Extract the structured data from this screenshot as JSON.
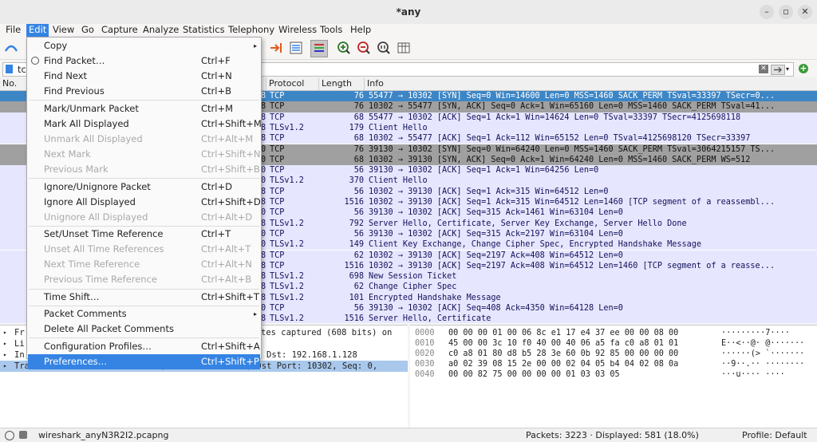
{
  "window": {
    "title": "*any",
    "minimize": "–",
    "maximize": "▫",
    "close": "✕"
  },
  "menubar": [
    "File",
    "Edit",
    "View",
    "Go",
    "Capture",
    "Analyze",
    "Statistics",
    "Telephony",
    "Wireless",
    "Tools",
    "Help"
  ],
  "filter": {
    "value": "tcp"
  },
  "columns": {
    "no": "No.",
    "protocol": "Protocol",
    "length": "Length",
    "info": "Info"
  },
  "packets": [
    {
      "p": "8",
      "proto": "TCP",
      "len": "76",
      "info": "55477 → 10302 [SYN] Seq=0 Win=14600 Len=0 MSS=1460 SACK_PERM TSval=33397 TSecr=0..."
    },
    {
      "p": "8",
      "proto": "TCP",
      "len": "76",
      "info": "10302 → 55477 [SYN, ACK] Seq=0 Ack=1 Win=65160 Len=0 MSS=1460 SACK_PERM TSval=41..."
    },
    {
      "p": "8",
      "proto": "TCP",
      "len": "68",
      "info": "55477 → 10302 [ACK] Seq=1 Ack=1 Win=14624 Len=0 TSval=33397 TSecr=4125698118"
    },
    {
      "p": "8",
      "proto": "TLSv1.2",
      "len": "179",
      "info": "Client Hello"
    },
    {
      "p": "8",
      "proto": "TCP",
      "len": "68",
      "info": "10302 → 55477 [ACK] Seq=1 Ack=112 Win=65152 Len=0 TSval=4125698120 TSecr=33397"
    },
    {
      "p": "0",
      "proto": "TCP",
      "len": "76",
      "info": "39130 → 10302 [SYN] Seq=0 Win=64240 Len=0 MSS=1460 SACK_PERM TSval=3064215157 TS..."
    },
    {
      "p": "0",
      "proto": "TCP",
      "len": "68",
      "info": "10302 → 39130 [SYN, ACK] Seq=0 Ack=1 Win=64240 Len=0 MSS=1460 SACK_PERM WS=512"
    },
    {
      "p": "0",
      "proto": "TCP",
      "len": "56",
      "info": "39130 → 10302 [ACK] Seq=1 Ack=1 Win=64256 Len=0"
    },
    {
      "p": "0",
      "proto": "TLSv1.2",
      "len": "370",
      "info": "Client Hello"
    },
    {
      "p": "8",
      "proto": "TCP",
      "len": "56",
      "info": "10302 → 39130 [ACK] Seq=1 Ack=315 Win=64512 Len=0"
    },
    {
      "p": "8",
      "proto": "TCP",
      "len": "1516",
      "info": "10302 → 39130 [ACK] Seq=1 Ack=315 Win=64512 Len=1460 [TCP segment of a reassembl..."
    },
    {
      "p": "0",
      "proto": "TCP",
      "len": "56",
      "info": "39130 → 10302 [ACK] Seq=315 Ack=1461 Win=63104 Len=0"
    },
    {
      "p": "8",
      "proto": "TLSv1.2",
      "len": "792",
      "info": "Server Hello, Certificate, Server Key Exchange, Server Hello Done"
    },
    {
      "p": "0",
      "proto": "TCP",
      "len": "56",
      "info": "39130 → 10302 [ACK] Seq=315 Ack=2197 Win=63104 Len=0"
    },
    {
      "p": "0",
      "proto": "TLSv1.2",
      "len": "149",
      "info": "Client Key Exchange, Change Cipher Spec, Encrypted Handshake Message"
    },
    {
      "p": "8",
      "proto": "TCP",
      "len": "62",
      "info": "10302 → 39130 [ACK] Seq=2197 Ack=408 Win=64512 Len=0"
    },
    {
      "p": "8",
      "proto": "TCP",
      "len": "1516",
      "info": "10302 → 39130 [ACK] Seq=2197 Ack=408 Win=64512 Len=1460 [TCP segment of a reasse..."
    },
    {
      "p": "8",
      "proto": "TLSv1.2",
      "len": "698",
      "info": "New Session Ticket"
    },
    {
      "p": "8",
      "proto": "TLSv1.2",
      "len": "62",
      "info": "Change Cipher Spec"
    },
    {
      "p": "8",
      "proto": "TLSv1.2",
      "len": "101",
      "info": "Encrypted Handshake Message"
    },
    {
      "p": "0",
      "proto": "TCP",
      "len": "56",
      "info": "39130 → 10302 [ACK] Seq=408 Ack=4350 Win=64128 Len=0"
    },
    {
      "p": "8",
      "proto": "TLSv1.2",
      "len": "1516",
      "info": "Server Hello, Certificate"
    }
  ],
  "details": [
    {
      "pre": "Fr",
      "post": "tes captured (608 bits) on"
    },
    {
      "pre": "Li",
      "post": ""
    },
    {
      "pre": "In",
      "post": "Dst: 192.168.1.128"
    },
    {
      "pre": "",
      "post": "Transmission Control Protocol, Src Port: 55477, Dst Port: 10302, Seq: 0,"
    }
  ],
  "bytes": [
    {
      "off": "0000",
      "hex": "00 00 00 01 00 06 8c e1  17 e4 37 ee 00 00 08 00",
      "ascii": "·········7····"
    },
    {
      "off": "0010",
      "hex": "45 00 00 3c 10 f0 40 00  40 06 a5 fa c0 a8 01 01",
      "ascii": "E··<··@· @·······"
    },
    {
      "off": "0020",
      "hex": "c0 a8 01 80 d8 b5 28 3e  60 0b 92 85 00 00 00 00",
      "ascii": "······(> `·······"
    },
    {
      "off": "0030",
      "hex": "a0 02 39 08 15 2e 00 00  02 04 05 b4 04 02 08 0a",
      "ascii": "··9··.·· ········"
    },
    {
      "off": "0040",
      "hex": "00 00 82 75 00 00 00 00  01 03 03 05",
      "ascii": "···u···· ····"
    }
  ],
  "statusbar": {
    "file": "wireshark_anyN3R2I2.pcapng",
    "packets": "Packets: 3223 · Displayed: 581 (18.0%)",
    "profile": "Profile: Default"
  },
  "edit_menu": [
    {
      "label": "Copy",
      "shortcut": "",
      "sub": true
    },
    {
      "label": "Find Packet…",
      "shortcut": "Ctrl+F",
      "icon": true
    },
    {
      "label": "Find Next",
      "shortcut": "Ctrl+N"
    },
    {
      "label": "Find Previous",
      "shortcut": "Ctrl+B"
    },
    {
      "sep": true
    },
    {
      "label": "Mark/Unmark Packet",
      "shortcut": "Ctrl+M"
    },
    {
      "label": "Mark All Displayed",
      "shortcut": "Ctrl+Shift+M"
    },
    {
      "label": "Unmark All Displayed",
      "shortcut": "Ctrl+Alt+M",
      "dis": true
    },
    {
      "label": "Next Mark",
      "shortcut": "Ctrl+Shift+N",
      "dis": true
    },
    {
      "label": "Previous Mark",
      "shortcut": "Ctrl+Shift+B",
      "dis": true
    },
    {
      "sep": true
    },
    {
      "label": "Ignore/Unignore Packet",
      "shortcut": "Ctrl+D"
    },
    {
      "label": "Ignore All Displayed",
      "shortcut": "Ctrl+Shift+D"
    },
    {
      "label": "Unignore All Displayed",
      "shortcut": "Ctrl+Alt+D",
      "dis": true
    },
    {
      "sep": true
    },
    {
      "label": "Set/Unset Time Reference",
      "shortcut": "Ctrl+T"
    },
    {
      "label": "Unset All Time References",
      "shortcut": "Ctrl+Alt+T",
      "dis": true
    },
    {
      "label": "Next Time Reference",
      "shortcut": "Ctrl+Alt+N",
      "dis": true
    },
    {
      "label": "Previous Time Reference",
      "shortcut": "Ctrl+Alt+B",
      "dis": true
    },
    {
      "sep": true
    },
    {
      "label": "Time Shift…",
      "shortcut": "Ctrl+Shift+T"
    },
    {
      "sep": true
    },
    {
      "label": "Packet Comments",
      "shortcut": "",
      "sub": true
    },
    {
      "label": "Delete All Packet Comments",
      "shortcut": ""
    },
    {
      "sep": true
    },
    {
      "label": "Configuration Profiles…",
      "shortcut": "Ctrl+Shift+A"
    },
    {
      "label": "Preferences…",
      "shortcut": "Ctrl+Shift+P",
      "hl": true
    }
  ],
  "colors": {
    "selected": "#3d86c6",
    "tcp": "#e7e6ff",
    "syn": "#a0a0a0",
    "menu_hl": "#3584e4"
  }
}
